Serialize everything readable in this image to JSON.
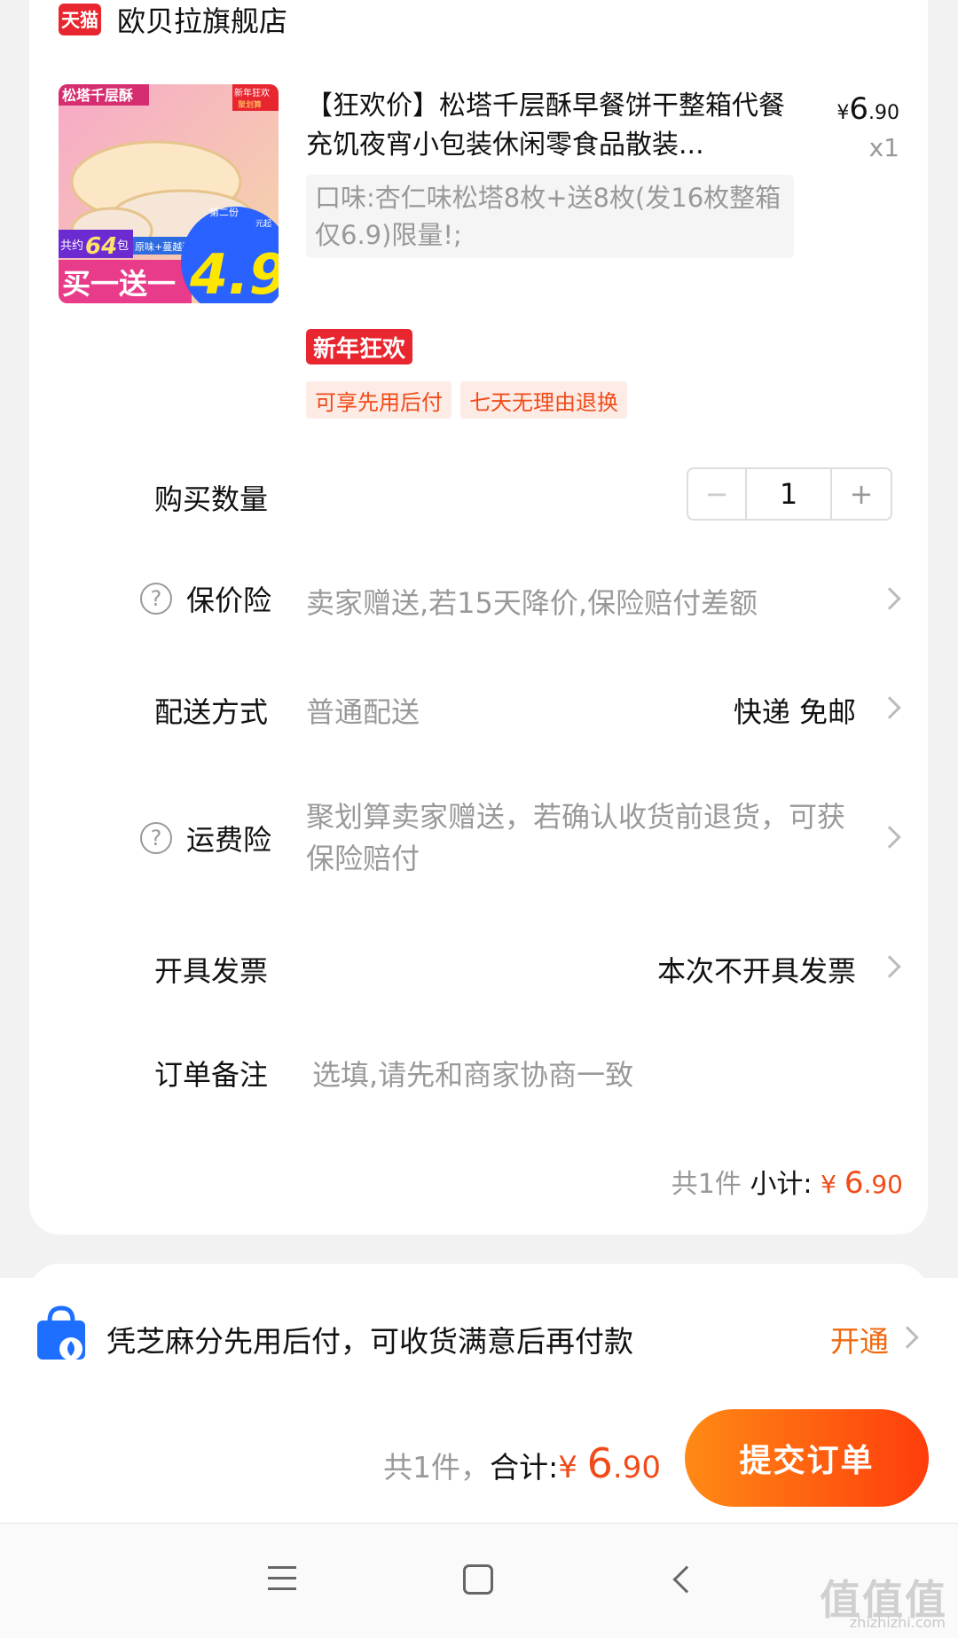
{
  "store": {
    "badge": "天猫",
    "name": "欧贝拉旗舰店"
  },
  "product": {
    "title": "【狂欢价】松塔千层酥早餐饼干整箱代餐充饥夜宵小包装休闲零食品散装...",
    "price_symbol": "¥",
    "price_int": "6",
    "price_dec": ".90",
    "quantity_label": "x1",
    "spec": "口味:杏仁味松塔8枚+送8枚(发16枚整箱仅6.9)限量!;",
    "promo_tag": "新年狂欢",
    "service_tags": [
      "可享先用后付",
      "七天无理由退换"
    ],
    "image_text": {
      "top_left": "松塔千层酥",
      "top_right": "新年狂欢",
      "top_right_sub": "聚划算",
      "count": "共约",
      "count_num": "64",
      "count_unit": "包",
      "flavor": "原味+蔓越莓味",
      "deal": "买一送一",
      "second": "第二份",
      "unit": "元起",
      "big_price": "4.9"
    }
  },
  "rows": {
    "quantity": {
      "label": "购买数量",
      "value": "1",
      "minus": "−",
      "plus": "+"
    },
    "price_insurance": {
      "label": "保价险",
      "value": "卖家赠送,若15天降价,保险赔付差额"
    },
    "delivery": {
      "label": "配送方式",
      "value": "普通配送",
      "right": "快递 免邮"
    },
    "freight_insurance": {
      "label": "运费险",
      "value": "聚划算卖家赠送，若确认收货前退货，可获保险赔付"
    },
    "invoice": {
      "label": "开具发票",
      "right": "本次不开具发票"
    },
    "note": {
      "label": "订单备注",
      "placeholder": "选填,请先和商家协商一致"
    }
  },
  "subtotal": {
    "count": "共1件",
    "label": "小计:",
    "symbol": "¥",
    "int": "6",
    "dec": ".90"
  },
  "credit": {
    "text": "凭芝麻分先用后付，可收货满意后再付款",
    "action": "开通"
  },
  "checkout": {
    "count": "共1件，",
    "label": "合计:",
    "symbol": "¥",
    "int": "6",
    "dec": ".90",
    "submit": "提交订单"
  },
  "watermark": {
    "main": "值值值",
    "sub": "zhizhizhi.com"
  },
  "colors": {
    "accent": "#f04b19",
    "tmall_red": "#e8262f",
    "button_start": "#ff8a14",
    "button_end": "#ff3d0c"
  },
  "icons": [
    "help-icon",
    "chevron-right-icon",
    "shopping-bag-icon",
    "nav-menu-icon",
    "nav-home-icon",
    "nav-back-icon"
  ]
}
